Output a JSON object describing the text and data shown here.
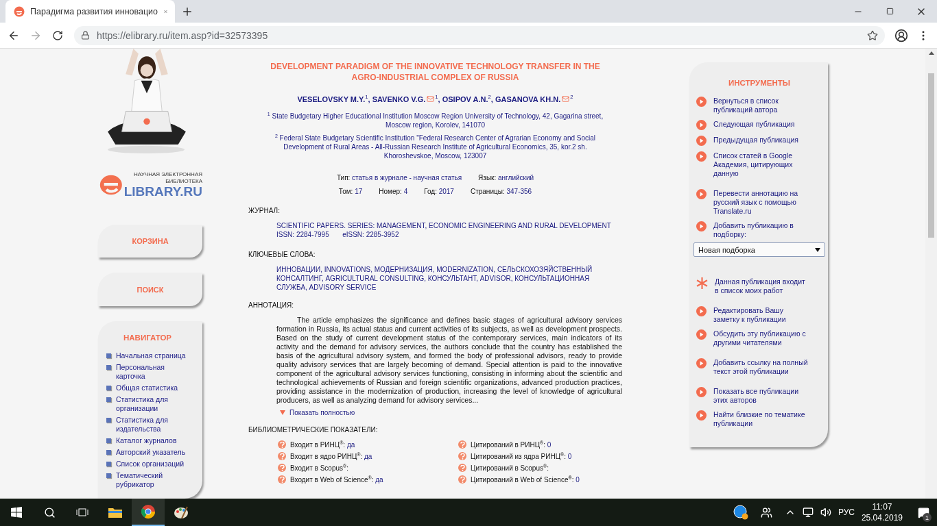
{
  "browser": {
    "tab_title": "Парадигма развития инновацио",
    "url": "https://elibrary.ru/item.asp?id=32573395"
  },
  "sidebar": {
    "logo": {
      "line_1": "НАУЧНАЯ ЭЛЕКТРОННАЯ",
      "line_2": "БИБЛИОТЕКА",
      "name": "LIBRARY.RU"
    },
    "buttons": [
      "КОРЗИНА",
      "ПОИСК"
    ],
    "navigator": {
      "title": "НАВИГАТОР",
      "items": [
        "Начальная страница",
        "Персональная карточка",
        "Общая статистика",
        "Статистика для организации",
        "Статистика для издательства",
        "Каталог журналов",
        "Авторский указатель",
        "Список организаций",
        "Тематический рубрикатор"
      ]
    }
  },
  "article": {
    "title": "DEVELOPMENT PARADIGM OF THE INNOVATIVE TECHNOLOGY TRANSFER IN THE AGRO-INDUSTRIAL COMPLEX OF RUSSIA",
    "authors": [
      {
        "name": "VESELOVSKY M.Y.",
        "affiliation": "1",
        "email": false,
        "separator": ","
      },
      {
        "name": "SAVENKO V.G.",
        "affiliation": "1",
        "email": true,
        "separator": ","
      },
      {
        "name": "OSIPOV A.N.",
        "affiliation": "2",
        "email": false,
        "separator": ","
      },
      {
        "name": "GASANOVA KH.N.",
        "affiliation": "2",
        "email": true
      }
    ],
    "affiliations": [
      {
        "number": "1",
        "text": "State Budgetary Higher Educational Institution Moscow Region University of Technology, 42, Gagarina street, Moscow region, Korolev, 141070"
      },
      {
        "number": "2",
        "text": "Federal State Budgetary Scientific Institution \"Federal Research Center of Agrarian Economy and Social Development of Rural Areas - All-Russian Research Institute of Agricultural Economics, 35, kor.2 sh. Khoroshevskoe, Moscow, 123007"
      }
    ],
    "meta_row_1": [
      {
        "label": "Тип:",
        "value": "статья в журнале - научная статья"
      },
      {
        "label": "Язык:",
        "value": "английский"
      }
    ],
    "meta_row_2": [
      {
        "label": "Том:",
        "value": "17"
      },
      {
        "label": "Номер:",
        "value": "4"
      },
      {
        "label": "Год:",
        "value": "2017"
      },
      {
        "label": "Страницы:",
        "value": "347-356"
      }
    ],
    "journal": {
      "heading": "ЖУРНАЛ:",
      "name": "SCIENTIFIC PAPERS. SERIES: MANAGEMENT, ECONOMIC ENGINEERING AND RURAL DEVELOPMENT",
      "issn_label": "ISSN:",
      "issn": "2284-7995",
      "eissn_label": "eISSN:",
      "eissn": "2285-3952"
    },
    "keywords": {
      "heading": "КЛЮЧЕВЫЕ СЛОВА:",
      "text": "ИННОВАЦИИ, INNOVATIONS, МОДЕРНИЗАЦИЯ, MODERNIZATION, СЕЛЬСКОХОЗЯЙСТВЕННЫЙ КОНСАЛТИНГ, AGRICULTURAL CONSULTING, КОНСУЛЬТАНТ, ADVISOR, КОНСУЛЬТАЦИОННАЯ СЛУЖБА, ADVISORY SERVICE"
    },
    "abstract": {
      "heading": "АННОТАЦИЯ:",
      "text": "The article emphasizes the significance and defines basic stages of agricultural advisory services formation in Russia, its actual status and current activities of its subjects, as well as development prospects. Based on the study of current development status of the contemporary services, main indicators of its activity and the demand for advisory services, the authors conclude that the country has established the basis of the agricultural advisory system, and formed the body of professional advisors, ready to provide quality advisory services that are largely becoming of demand. Special attention is paid to the innovative component of the agricultural advisory services functioning, consisting in informing about the scientific and technological achievements of Russian and foreign scientific organizations, advanced production practices, providing assistance in the modernization of production, increasing the level of knowledge of agricultural producers, as well as analyzing demand for advisory services...",
      "show_more": "Показать полностью"
    },
    "metrics": {
      "heading": "БИБЛИОМЕТРИЧЕСКИЕ ПОКАЗАТЕЛИ:",
      "rows": [
        [
          {
            "label": "Входит в РИНЦ$^{®}$:",
            "value": "да"
          },
          {
            "label": "Цитирований в РИНЦ$^{®}$:",
            "value": "0"
          }
        ],
        [
          {
            "label": "Входит в ядро РИНЦ$^{®}$:",
            "value": "да"
          },
          {
            "label": "Цитирований из ядра РИНЦ$^{®}$:",
            "value": "0"
          }
        ],
        [
          {
            "label": "Входит в Scopus$^{®}$:"
          },
          {
            "label": "Цитирований в Scopus$^{®}$:"
          }
        ],
        [
          {
            "label": "Входит в Web of Science$^{®}$:",
            "value": "да"
          },
          {
            "label": "Цитирований в Web of Science$^{®}$:",
            "value": "0"
          }
        ]
      ]
    }
  },
  "tools": {
    "title": "ИНСТРУМЕНТЫ",
    "groups": [
      [
        {
          "kind": "link",
          "text": "Вернуться в список публикаций автора"
        },
        {
          "kind": "link",
          "text": "Следующая публикация"
        },
        {
          "kind": "link",
          "text": "Предыдущая публикация"
        },
        {
          "kind": "link",
          "text": "Список статей в Google Академия, цитирующих данную"
        }
      ],
      [
        {
          "kind": "link",
          "text": "Перевести аннотацию на русский язык с помощью Translate.ru"
        },
        {
          "kind": "link",
          "text": "Добавить публикацию в подборку:"
        },
        {
          "kind": "select",
          "value": "Новая подборка"
        }
      ],
      [
        {
          "kind": "mine",
          "text": "Данная публикация входит в список моих работ"
        }
      ],
      [
        {
          "kind": "link",
          "text": "Редактировать Вашу заметку к публикации"
        },
        {
          "kind": "link",
          "text": "Обсудить эту публикацию с другими читателями"
        }
      ],
      [
        {
          "kind": "link",
          "text": "Добавить ссылку на полный текст этой публикации"
        }
      ],
      [
        {
          "kind": "link",
          "text": "Показать все публикации этих авторов"
        },
        {
          "kind": "link",
          "text": "Найти близкие по тематике публикации"
        }
      ]
    ]
  },
  "taskbar": {
    "language": "РУС",
    "time": "11:07",
    "date": "25.04.2019",
    "notifications": "1"
  }
}
